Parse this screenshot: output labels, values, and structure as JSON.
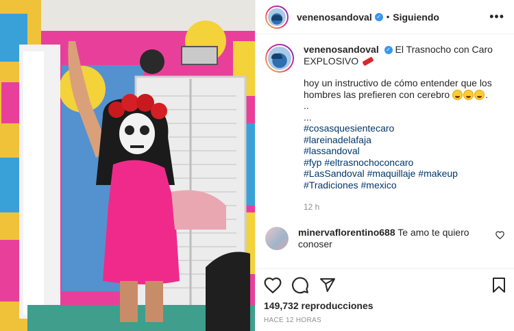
{
  "post": {
    "username": "venenosandoval",
    "follow_status": "Siguiendo",
    "separator": "•",
    "more_icon": "more-options-icon"
  },
  "caption": {
    "username": "venenosandoval",
    "line1": "El Trasnocho con Caro EXPLOSIVO",
    "line2": "hoy un instructivo de cómo entender que los hombres las prefieren con cerebro",
    "dots1": "..",
    "dots2": "...",
    "hashtags": [
      "#cosasquesientecaro",
      "#lareinadelafaja",
      "#lassandoval",
      "#fyp #eltrasnochoconcaro",
      "#LasSandoval #maquillaje #makeup",
      "#Tradiciones #mexico"
    ],
    "time": "12 h"
  },
  "comment": {
    "username": "minervaflorentino688",
    "text": "Te amo te quiero conoser"
  },
  "stats": {
    "views": "149,732 reproducciones",
    "posted_ago": "HACE 12 HORAS"
  },
  "colors": {
    "link": "#00376b",
    "verified": "#3897f0",
    "muted": "#8e8e8e"
  }
}
